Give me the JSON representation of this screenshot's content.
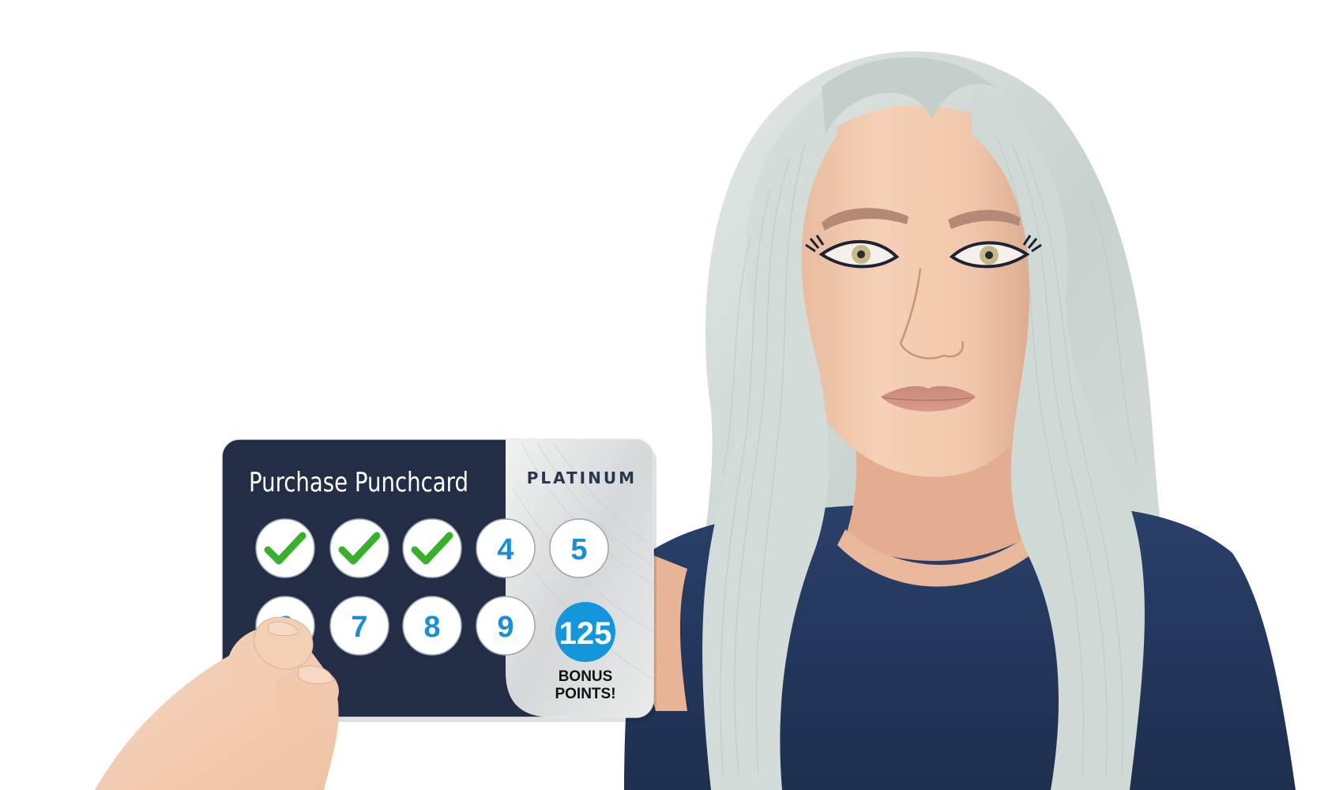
{
  "card": {
    "title": "Purchase Punchcard",
    "tier": "PLATINUM",
    "punches": [
      {
        "label": "1",
        "punched": true
      },
      {
        "label": "2",
        "punched": true
      },
      {
        "label": "3",
        "punched": true
      },
      {
        "label": "4",
        "punched": false
      },
      {
        "label": "5",
        "punched": false
      },
      {
        "label": "6",
        "punched": false
      },
      {
        "label": "7",
        "punched": false
      },
      {
        "label": "8",
        "punched": false
      },
      {
        "label": "9",
        "punched": false
      }
    ],
    "bonus": {
      "value": "125",
      "line1": "BONUS",
      "line2": "POINTS!"
    },
    "punched_count": 3,
    "total_slots": 10
  },
  "colors": {
    "card_navy": "#232d45",
    "shirt_navy": "#233759",
    "silver": "#dcdfe0",
    "check_green": "#39b02c",
    "number_blue": "#1d8ed6",
    "bonus_blue": "#1596dc",
    "hair": "#c9d3cf",
    "skin": "#efc2a4"
  }
}
